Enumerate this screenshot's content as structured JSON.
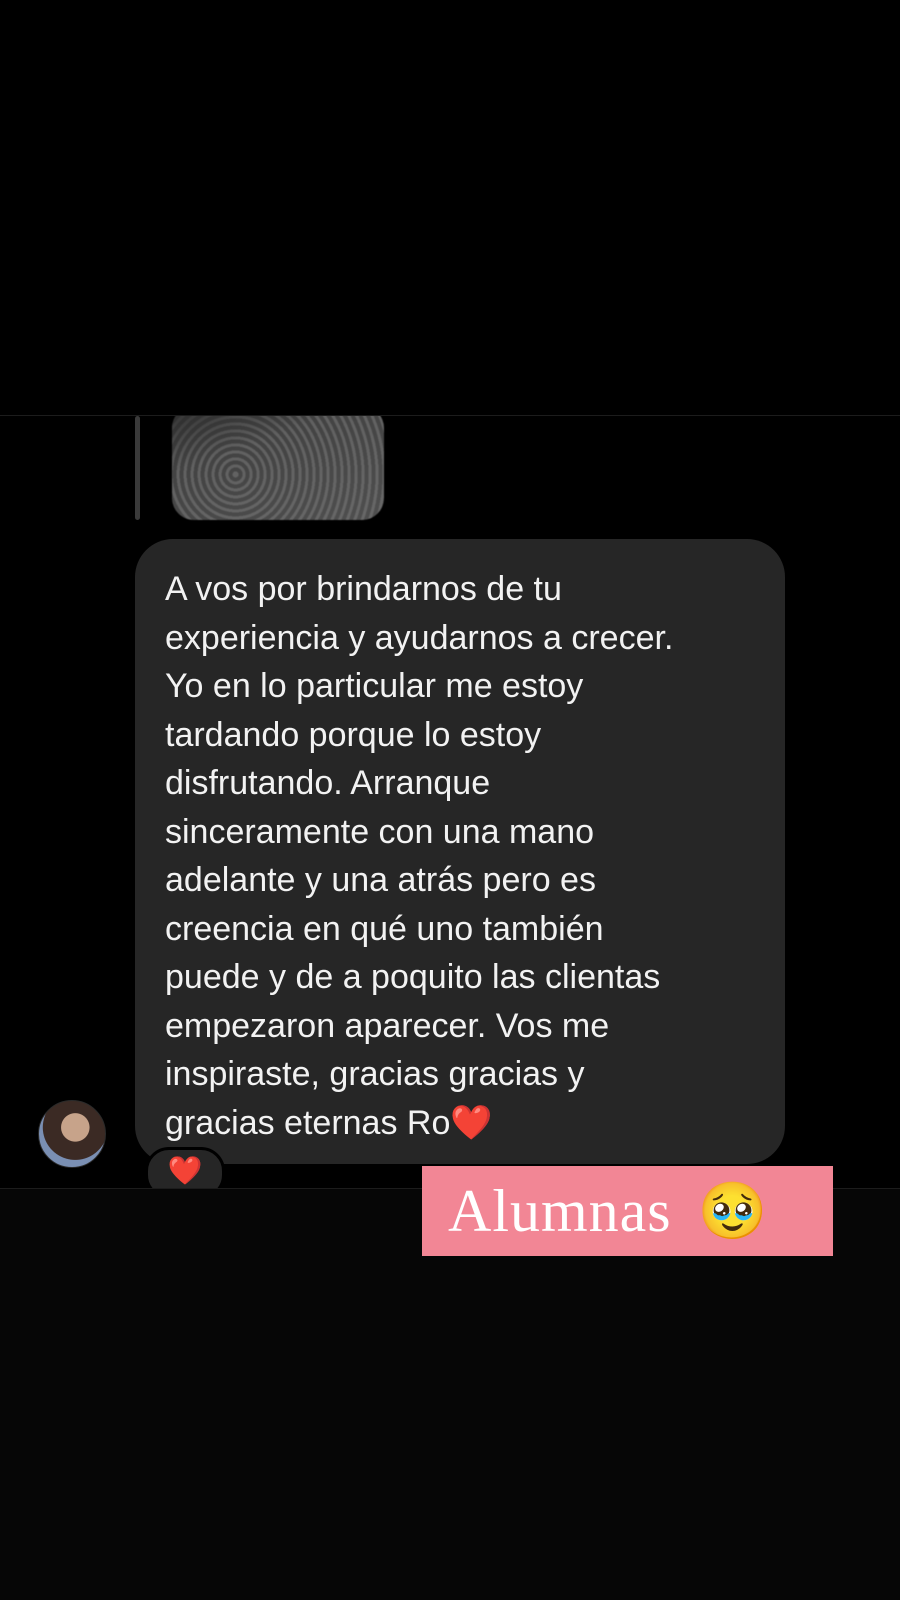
{
  "message": {
    "text": "A vos por brindarnos de tu\nexperiencia y ayudarnos a crecer.\nYo en lo particular me estoy\ntardando porque lo estoy\ndisfrutando. Arranque\nsinceramente con una mano\nadelante y una atrás pero es\ncreencia en qué uno también\npuede y de a poquito las clientas\nempezaron aparecer. Vos me\ninspiraste, gracias gracias y\ngracias eternas Ro",
    "inline_emoji": "❤️",
    "reaction": "❤️"
  },
  "overlay_label": {
    "text": "Alumnas",
    "emoji": "🥹"
  },
  "colors": {
    "background": "#000000",
    "bubble": "#262626",
    "label_background": "#f28695",
    "heart": "#e8243a"
  },
  "icons": {
    "avatar": "user-avatar",
    "reply_preview": "reply-image-thumbnail"
  }
}
